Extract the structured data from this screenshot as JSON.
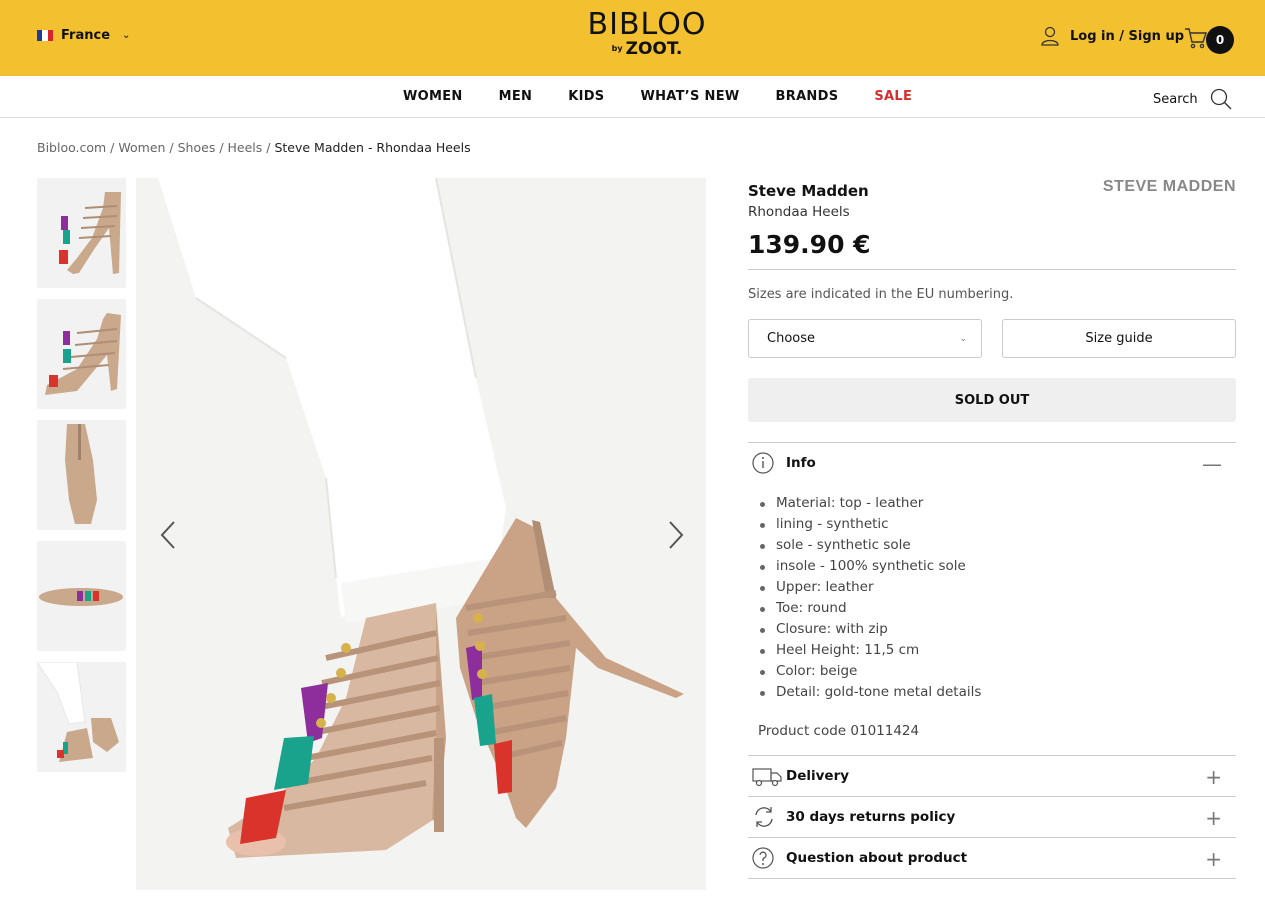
{
  "header": {
    "country": "France",
    "logo_main": "BIBLOO",
    "logo_by": "by",
    "logo_sub": "ZOOT.",
    "login": "Log in / Sign up",
    "cart_count": "0"
  },
  "nav": {
    "items": [
      {
        "label": "WOMEN"
      },
      {
        "label": "MEN"
      },
      {
        "label": "KIDS"
      },
      {
        "label": "WHAT’S NEW"
      },
      {
        "label": "BRANDS"
      },
      {
        "label": "SALE"
      }
    ],
    "search_label": "Search"
  },
  "breadcrumb": {
    "items": [
      "Bibloo.com",
      "Women",
      "Shoes",
      "Heels"
    ],
    "current": "Steve Madden - Rhondaa Heels",
    "separator": " / "
  },
  "product": {
    "brand": "Steve Madden",
    "brand_logo": "STEVE MADDEN",
    "model": "Rhondaa Heels",
    "price": "139.90 €",
    "sizes_note": "Sizes are indicated in the EU numbering.",
    "size_select": "Choose",
    "size_guide": "Size guide",
    "sold_out": "SOLD OUT",
    "info_title": "Info",
    "info_items": [
      "Material: top - leather",
      "lining - synthetic",
      "sole - synthetic sole",
      "insole - 100% synthetic sole",
      "Upper: leather",
      "Toe: round",
      "Closure: with zip",
      "Heel Height: 11,5 cm",
      "Color: beige",
      "Detail: gold-tone metal details"
    ],
    "product_code": "Product code 01011424",
    "delivery": "Delivery",
    "returns": "30 days returns policy",
    "question": "Question about product"
  },
  "colors": {
    "topbar": "#f3c02f",
    "sale": "#d32f2f",
    "shoe": "#c9a88c"
  }
}
